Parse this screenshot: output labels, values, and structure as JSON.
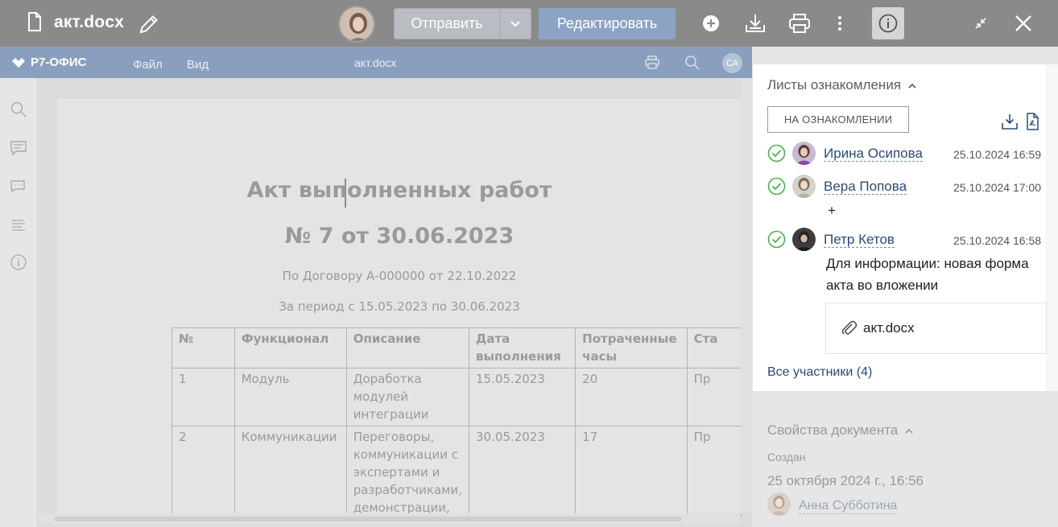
{
  "topbar": {
    "file_name": "акт.docx",
    "send_label": "Отправить",
    "edit_label": "Редактировать"
  },
  "editor": {
    "logo": "Р7-ОФИС",
    "menu": [
      "Файл",
      "Вид"
    ],
    "doc_name": "акт.docx",
    "user_initials": "СА"
  },
  "document": {
    "title": "Акт выполненных работ",
    "number_line": "№ 7 от 30.06.2023",
    "contract_line": "По Договору А-000000 от 22.10.2022",
    "period_line": "За период с 15.05.2023 по 30.06.2023",
    "table": {
      "headers": [
        "№",
        "Функционал",
        "Описание",
        "Дата выполнения",
        "Потраченные часы",
        "Ста"
      ],
      "rows": [
        [
          "1",
          "Модуль",
          "Доработка модулей интеграции",
          "15.05.2023",
          "20",
          "Пр"
        ],
        [
          "2",
          "Коммуникации",
          "Переговоры, коммуникации с экспертами и разработчиками, демонстрации,",
          "30.05.2023",
          "17",
          "Пр"
        ]
      ]
    }
  },
  "familiarization": {
    "section_title": "Листы ознакомления",
    "status_button": "НА ОЗНАКОМЛЕНИИ",
    "entries": [
      {
        "name": "Ирина Осипова",
        "time": "25.10.2024 16:59",
        "comment": ""
      },
      {
        "name": "Вера Попова",
        "time": "25.10.2024 17:00",
        "comment": "+"
      },
      {
        "name": "Петр Кетов",
        "time": "25.10.2024 16:58",
        "comment": "Для информации: новая форма акта во вложении"
      }
    ],
    "attachment": "акт.docx",
    "all_participants": "Все участники (4)"
  },
  "properties": {
    "section_title": "Свойства документа",
    "created_label": "Создан",
    "created_date": "25 октября 2024 г., 16:56",
    "author": "Анна Субботина"
  },
  "colors": {
    "accent": "#2a4b78",
    "check": "#4caf50",
    "edit_button": "#8da3c4"
  }
}
